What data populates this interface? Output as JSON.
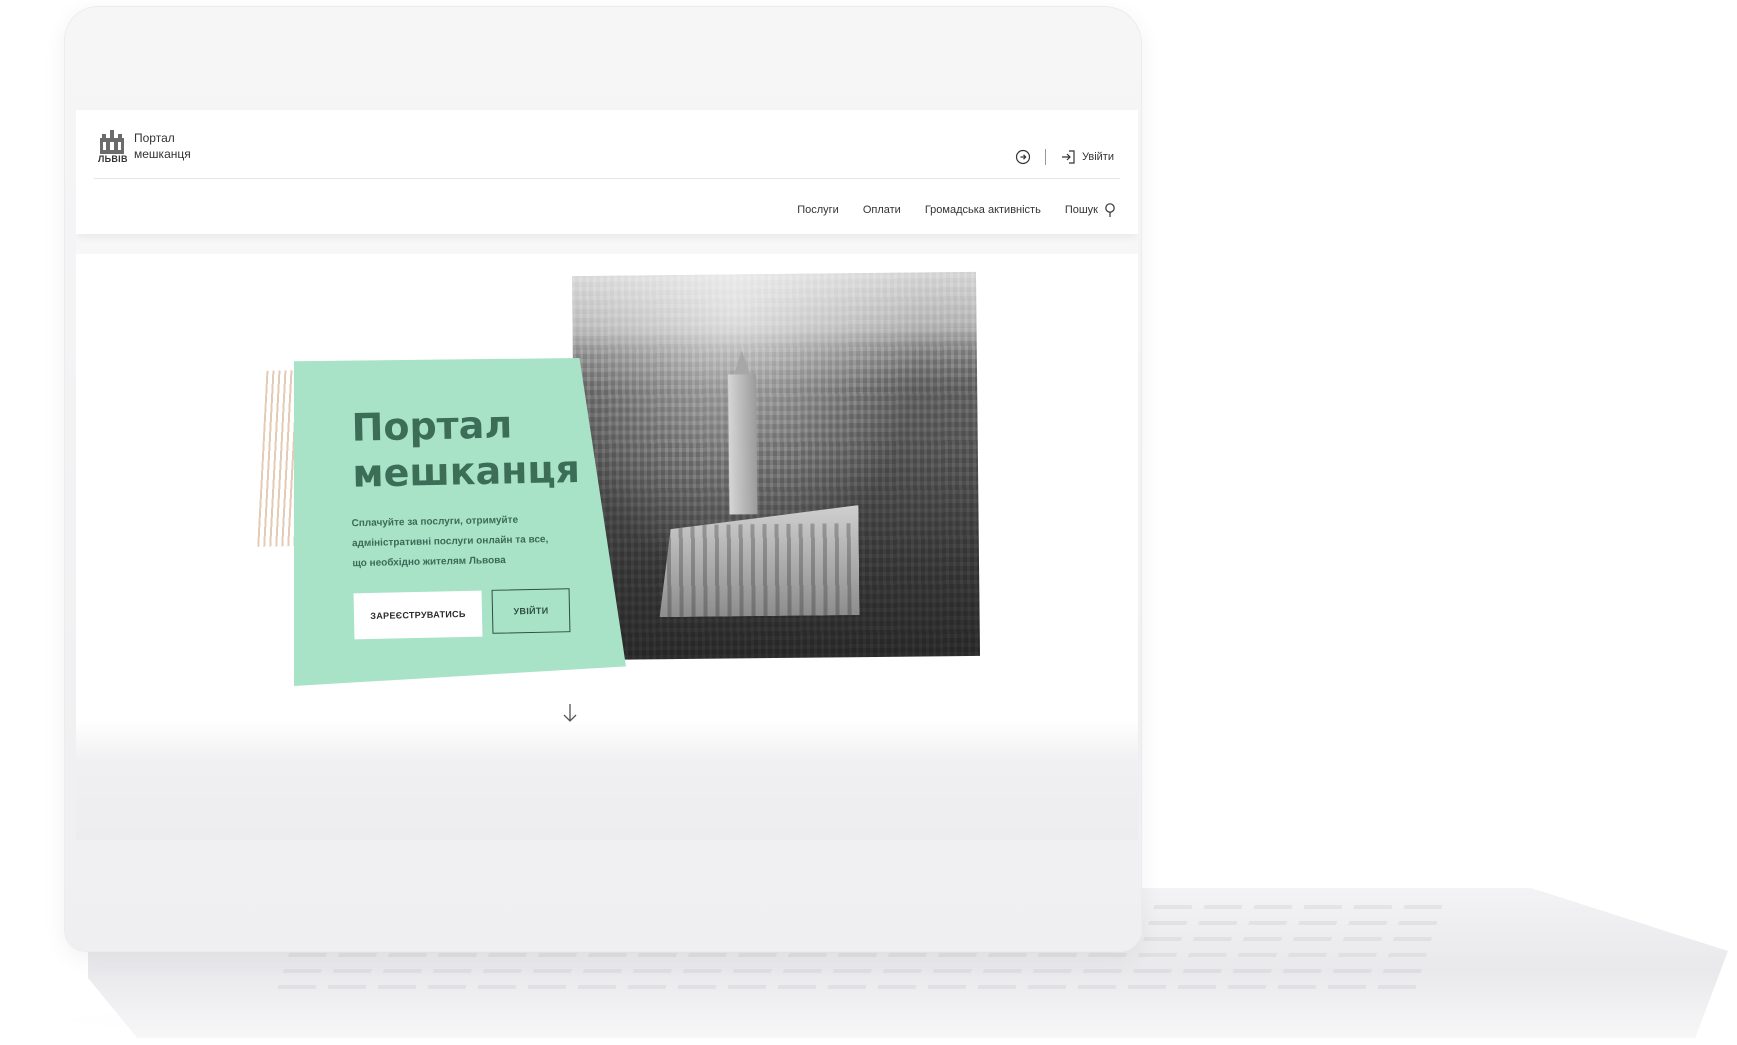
{
  "header": {
    "logo_city": "ЛЬВІВ",
    "brand_line1": "Портал",
    "brand_line2": "мешканця",
    "login_label": "Увійти"
  },
  "nav": {
    "items": [
      {
        "label": "Послуги"
      },
      {
        "label": "Оплати"
      },
      {
        "label": "Громадська активність"
      }
    ],
    "search_label": "Пошук"
  },
  "hero": {
    "title_line1": "Портал",
    "title_line2": "мешканця",
    "subtitle": "Сплачуйте за послуги, отримуйте адміністративні послуги онлайн та все, що необхідно жителям Львова",
    "register_button": "ЗАРЕЄСТРУВАТИСЬ",
    "login_button": "УВІЙТИ"
  },
  "colors": {
    "accent_green": "#a8e3c8",
    "title_green": "#3c6d57",
    "stripe_beige": "#e2c8b1"
  },
  "icons": {
    "language": "globe-arrow-icon",
    "login": "sign-in-icon",
    "search": "search-icon",
    "scroll": "arrow-down-icon"
  }
}
